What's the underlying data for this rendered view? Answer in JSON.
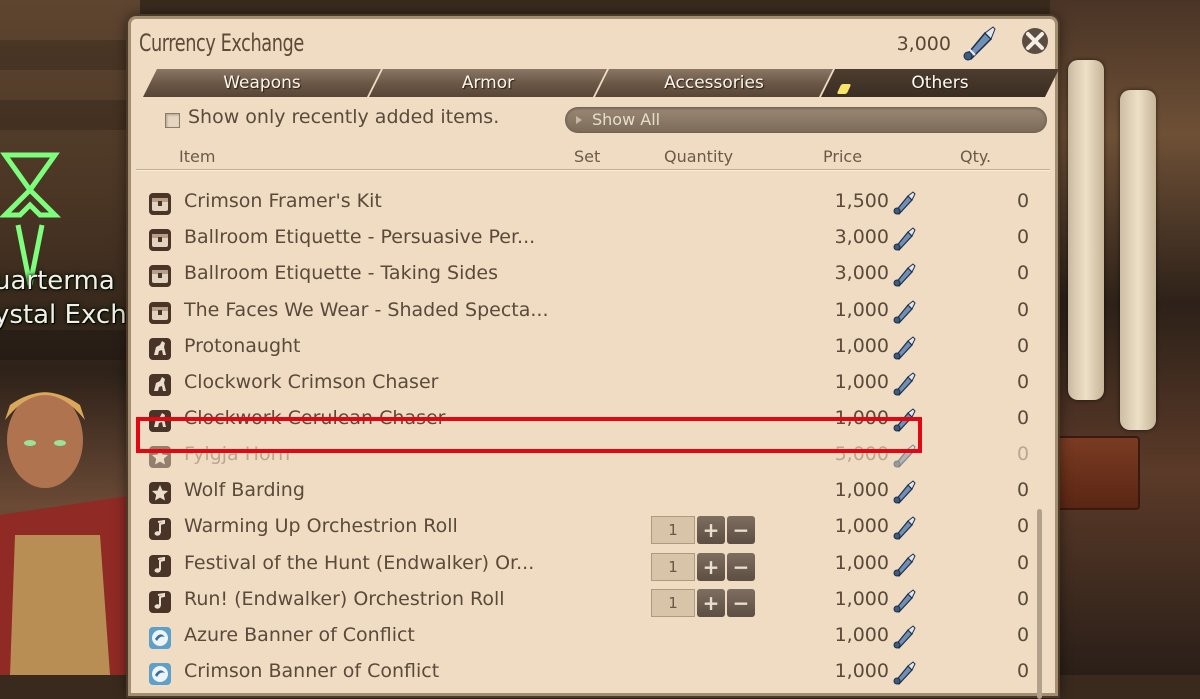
{
  "background": {
    "npc_name_lines": [
      "uarterma",
      "ystal Exch"
    ]
  },
  "window": {
    "title": "Currency Exchange",
    "currency_amount": "3,000",
    "currency_icon": "allied-seal-icon"
  },
  "tabs": [
    {
      "label": "Weapons",
      "active": false
    },
    {
      "label": "Armor",
      "active": false
    },
    {
      "label": "Accessories",
      "active": false
    },
    {
      "label": "Others",
      "active": true
    }
  ],
  "filter": {
    "checkbox_label": "Show only recently added items.",
    "checked": false,
    "dropdown_label": "Show All"
  },
  "columns": {
    "item": "Item",
    "set": "Set",
    "quantity": "Quantity",
    "price": "Price",
    "qty": "Qty."
  },
  "items": [
    {
      "name": "Crimson Framer's Kit",
      "icon": "chest-icon",
      "price": "1,500",
      "qty": "0",
      "stepper": null,
      "dim": false
    },
    {
      "name": "Ballroom Etiquette - Persuasive Per...",
      "icon": "chest-icon",
      "price": "3,000",
      "qty": "0",
      "stepper": null,
      "dim": false
    },
    {
      "name": "Ballroom Etiquette - Taking Sides",
      "icon": "chest-icon",
      "price": "3,000",
      "qty": "0",
      "stepper": null,
      "dim": false
    },
    {
      "name": "The Faces We Wear - Shaded Specta...",
      "icon": "chest-icon",
      "price": "1,000",
      "qty": "0",
      "stepper": null,
      "dim": false
    },
    {
      "name": "Protonaught",
      "icon": "mount-icon",
      "price": "1,000",
      "qty": "0",
      "stepper": null,
      "dim": false
    },
    {
      "name": "Clockwork Crimson Chaser",
      "icon": "mount-icon",
      "price": "1,000",
      "qty": "0",
      "stepper": null,
      "dim": false
    },
    {
      "name": "Clockwork Cerulean Chaser",
      "icon": "mount-icon",
      "price": "1,000",
      "qty": "0",
      "stepper": null,
      "dim": false
    },
    {
      "name": "Fylgja Horn",
      "icon": "star-icon",
      "price": "5,000",
      "qty": "0",
      "stepper": null,
      "dim": true
    },
    {
      "name": "Wolf Barding",
      "icon": "star-icon",
      "price": "1,000",
      "qty": "0",
      "stepper": null,
      "dim": false
    },
    {
      "name": "Warming Up Orchestrion Roll",
      "icon": "music-note-icon",
      "price": "1,000",
      "qty": "0",
      "stepper": {
        "value": "1",
        "plus": "+",
        "minus": "−"
      },
      "dim": false
    },
    {
      "name": "Festival of the Hunt (Endwalker) Or...",
      "icon": "music-note-icon",
      "price": "1,000",
      "qty": "0",
      "stepper": {
        "value": "1",
        "plus": "+",
        "minus": "−"
      },
      "dim": false
    },
    {
      "name": "Run! (Endwalker) Orchestrion Roll",
      "icon": "music-note-icon",
      "price": "1,000",
      "qty": "0",
      "stepper": {
        "value": "1",
        "plus": "+",
        "minus": "−"
      },
      "dim": false
    },
    {
      "name": "Azure Banner of Conflict",
      "icon": "banner-icon",
      "price": "1,000",
      "qty": "0",
      "stepper": null,
      "dim": false
    },
    {
      "name": "Crimson Banner of Conflict",
      "icon": "banner-icon",
      "price": "1,000",
      "qty": "0",
      "stepper": null,
      "dim": false
    }
  ],
  "highlighted_item": "Fylgja Horn",
  "colors": {
    "panel": "#efdcc3",
    "text": "#5b4a3b",
    "dim_text": "#b9a794",
    "highlight": "#e30613",
    "tab_active": "#3a2d22"
  }
}
